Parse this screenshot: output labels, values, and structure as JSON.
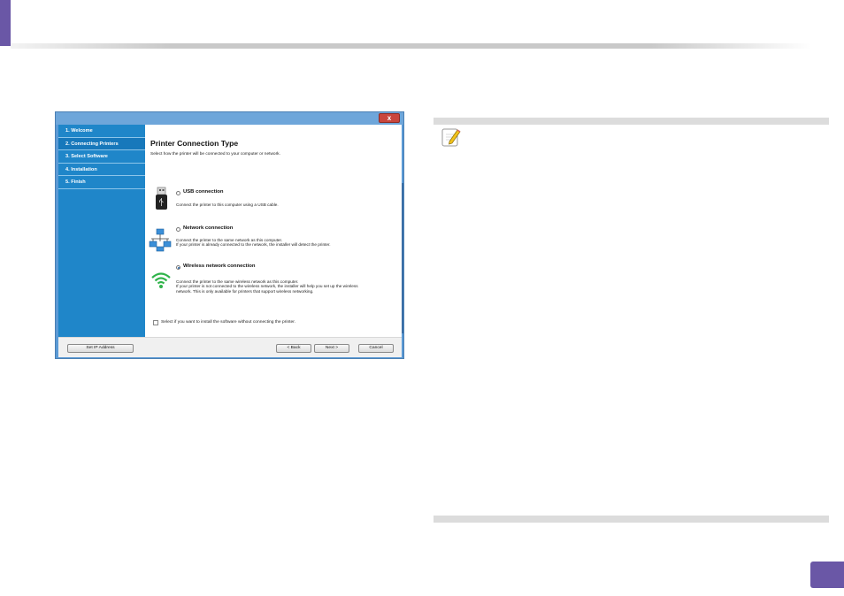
{
  "installer": {
    "close_label": "x",
    "steps": [
      {
        "label": "1. Welcome"
      },
      {
        "label": "2. Connecting Printers"
      },
      {
        "label": "3. Select Software"
      },
      {
        "label": "4. Installation"
      },
      {
        "label": "5. Finish"
      }
    ],
    "active_step": 1,
    "title": "Printer Connection Type",
    "subtitle": "Select how the printer will be connected to your computer or network.",
    "options": [
      {
        "label": "USB connection",
        "desc": [
          "Connect the printer to this computer using a USB cable."
        ],
        "selected": false,
        "icon": "usb-icon"
      },
      {
        "label": "Network connection",
        "desc": [
          "Connect the printer to the same network as this computer.",
          "If your printer is already connected to the network, the installer will detect the printer."
        ],
        "selected": false,
        "icon": "network-icon"
      },
      {
        "label": "Wireless network connection",
        "desc": [
          "Connect the printer to the same wireless network as this computer.",
          "If your printer is not connected to the wireless network, the installer will help you set up the wireless",
          "network. This is only available for printers that support wireless networking."
        ],
        "selected": true,
        "icon": "wireless-icon"
      }
    ],
    "skip_checkbox": {
      "label": "Select if you want to install the software without connecting the printer.",
      "checked": false
    },
    "buttons": {
      "set_ip": "Set IP Address",
      "back": "< Back",
      "next": "Next >",
      "cancel": "Cancel"
    }
  },
  "note": {
    "icon": "note-pencil-icon"
  },
  "colors": {
    "accent": "#6a57a6",
    "sidebar": "#1f86c9",
    "window_frame": "#5b9ad5"
  }
}
